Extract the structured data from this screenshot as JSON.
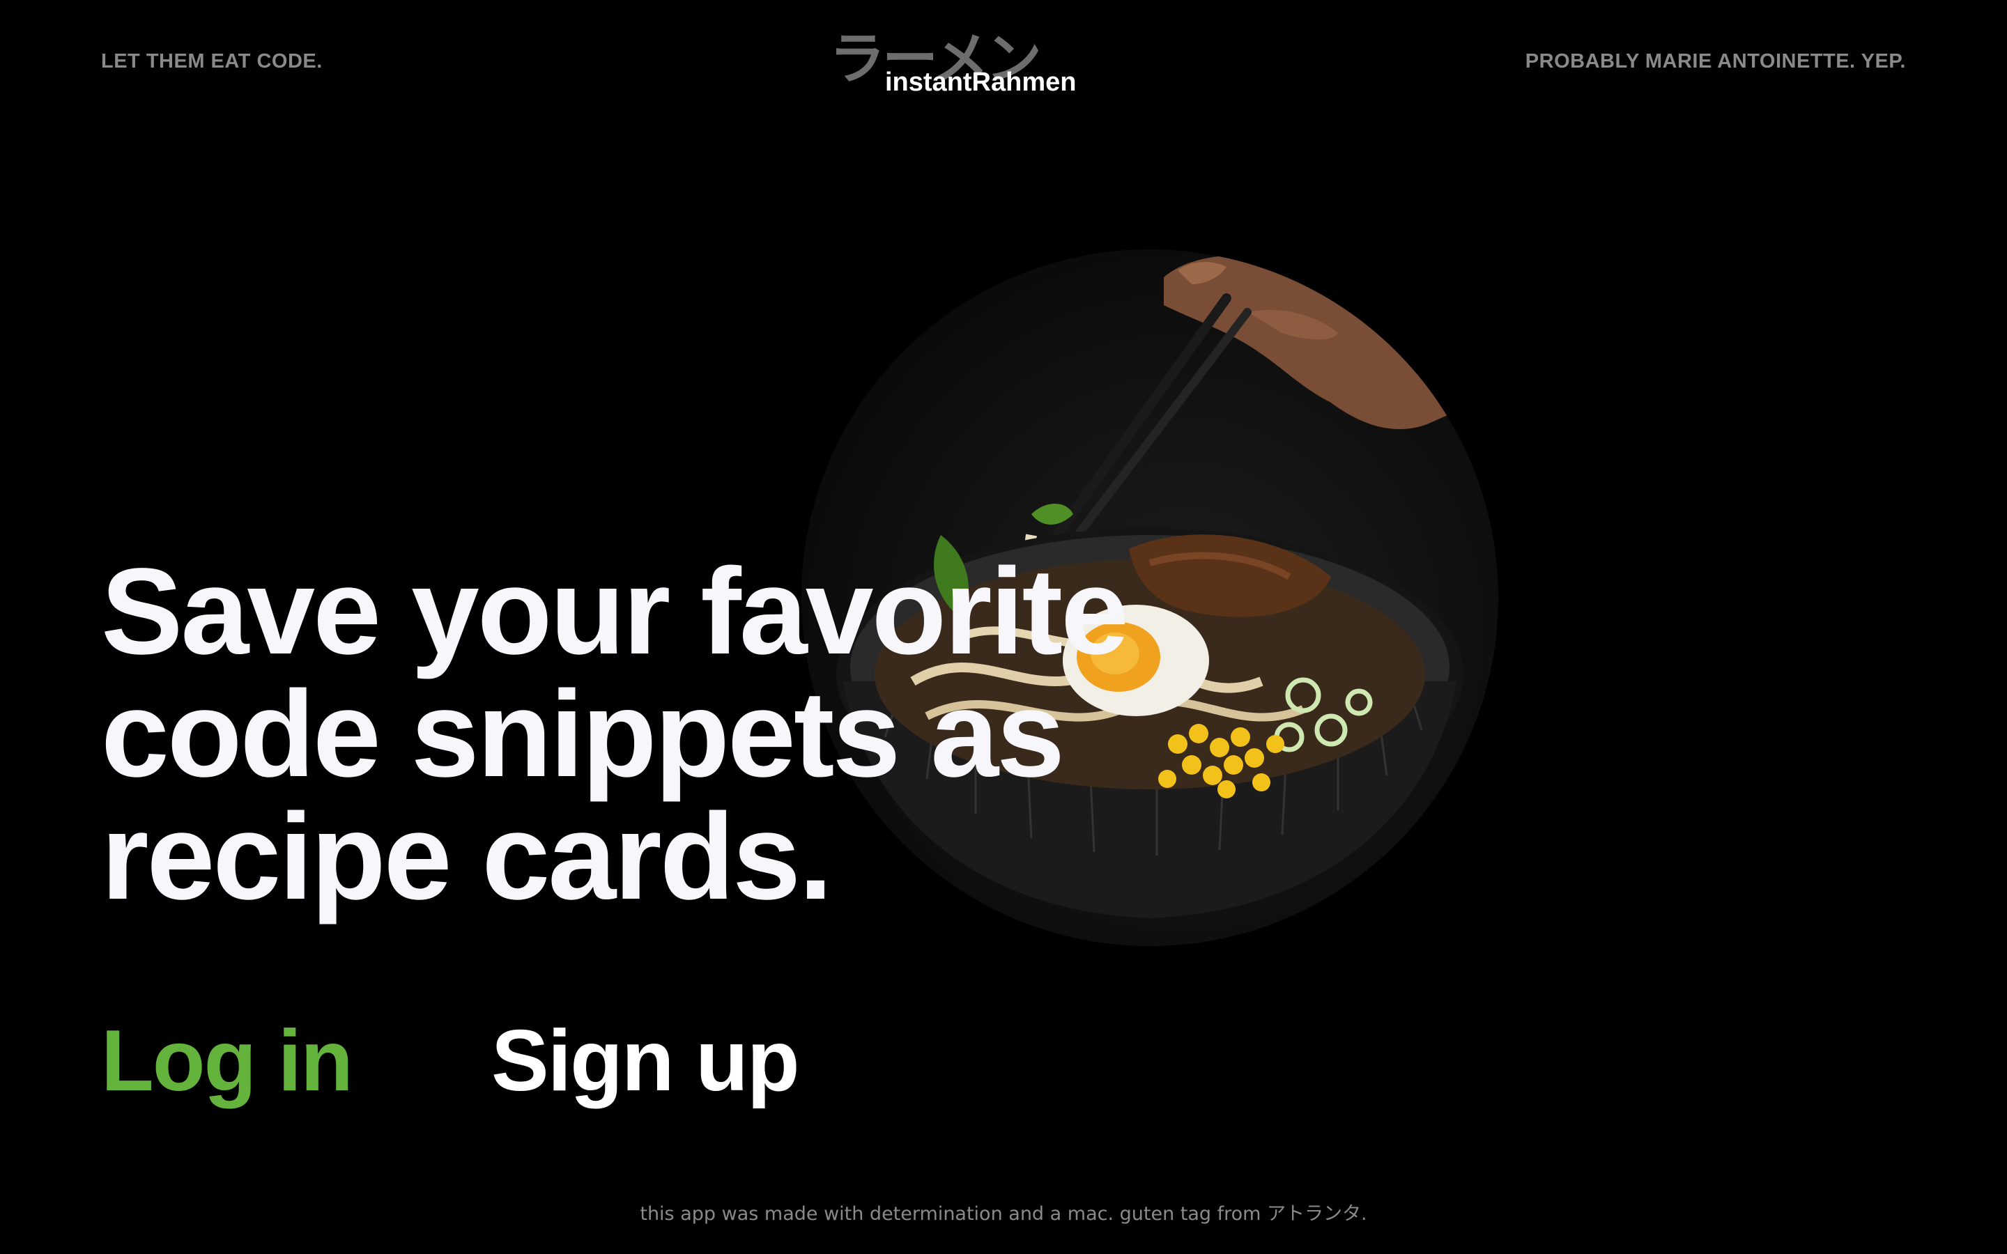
{
  "header": {
    "tagline_left": "LET THEM EAT CODE.",
    "tagline_right": "PROBABLY MARIE ANTOINETTE. YEP.",
    "logo_jp": "ラーメン",
    "logo_en": "instantRahmen"
  },
  "hero": {
    "headline_lines": [
      "Save your favorite",
      "code snippets as",
      "recipe cards."
    ],
    "image": "ramen-bowl-with-chopsticks-photo"
  },
  "auth": {
    "login_label": "Log in",
    "signup_label": "Sign up"
  },
  "footer": {
    "text": "this app was made with determination and a mac. guten tag from アトランタ."
  },
  "colors": {
    "background": "#000000",
    "accent_green": "#63b33c",
    "muted_text": "#8a8a8a",
    "headline_text": "#f7f7fb"
  }
}
